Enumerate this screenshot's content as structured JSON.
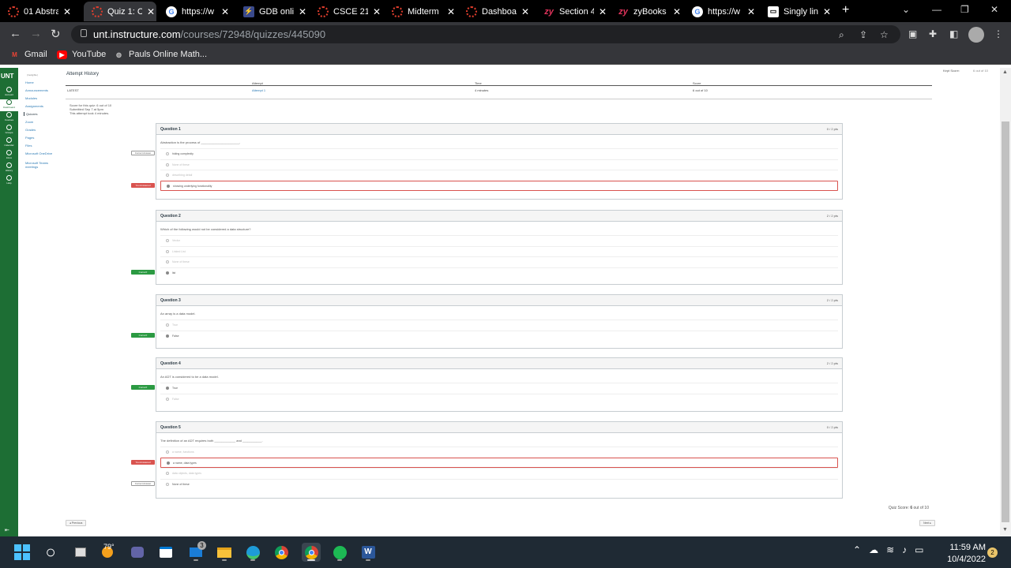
{
  "browser": {
    "tabs": [
      {
        "title": "01 Abstra",
        "icon": "canvas-icon",
        "active": false
      },
      {
        "title": "Quiz 1: C",
        "icon": "canvas-icon",
        "active": true
      },
      {
        "title": "https://w",
        "icon": "google-icon",
        "active": false
      },
      {
        "title": "GDB onli",
        "icon": "gdb-icon",
        "active": false
      },
      {
        "title": "CSCE 21",
        "icon": "canvas-icon",
        "active": false
      },
      {
        "title": "Midterm",
        "icon": "canvas-icon",
        "active": false
      },
      {
        "title": "Dashboa",
        "icon": "canvas-icon",
        "active": false
      },
      {
        "title": "Section 4",
        "icon": "zybooks-icon",
        "active": false
      },
      {
        "title": "zyBooks",
        "icon": "zybooks-icon",
        "active": false
      },
      {
        "title": "https://w",
        "icon": "google-icon",
        "active": false
      },
      {
        "title": "Singly lin",
        "icon": "window-icon",
        "active": false
      }
    ],
    "url_domain": "unt.instructure.com",
    "url_path": "/courses/72948/quizzes/445090",
    "bookmarks": [
      {
        "label": "Gmail",
        "icon": "gmail-icon"
      },
      {
        "label": "YouTube",
        "icon": "youtube-icon"
      },
      {
        "label": "Pauls Online Math...",
        "icon": "globe-icon"
      }
    ]
  },
  "global_nav": {
    "logo": "UNT",
    "items": [
      "Account",
      "Dashboard",
      "Courses",
      "Groups",
      "Calendar",
      "Inbox",
      "History",
      "Help"
    ],
    "active": "Dashboard"
  },
  "course_nav": {
    "term": "(Ineligible)",
    "items": [
      "Home",
      "Announcements",
      "Modules",
      "Assignments",
      "Quizzes",
      "Zoom",
      "Grades",
      "Pages",
      "Files",
      "Microsoft OneDrive",
      "Microsoft Teams meetings"
    ],
    "active": "Quizzes"
  },
  "attempt_history": {
    "title": "Attempt History",
    "headers": [
      "Attempt",
      "Time",
      "Score"
    ],
    "row": {
      "label": "LATEST",
      "attempt": "Attempt 1",
      "time": "4 minutes",
      "score": "6 out of 10"
    }
  },
  "summary": {
    "line1": "Score for this quiz: 6 out of 10",
    "line2": "Submitted Sep 7 at 5pm",
    "line3": "This attempt took 4 minutes."
  },
  "kept_score": {
    "label": "Kept Score:",
    "value": "6 out of 10"
  },
  "questions": [
    {
      "name": "Question 1",
      "points": "0 / 2 pts",
      "text": "Abstraction is the process of ______________________.",
      "answers": [
        {
          "text": "hiding complexity",
          "selected": false,
          "faded": false,
          "tag": "Correct Answer",
          "tag_style": "gray"
        },
        {
          "text": "None of these",
          "selected": false,
          "faded": true,
          "tag": "",
          "tag_style": ""
        },
        {
          "text": "describing detail",
          "selected": false,
          "faded": true,
          "tag": "",
          "tag_style": ""
        },
        {
          "text": "showing underlying functionality",
          "selected": true,
          "faded": false,
          "tag": "You Answered",
          "tag_style": "red"
        }
      ]
    },
    {
      "name": "Question 2",
      "points": "2 / 2 pts",
      "text": "Which of the following would not be considered a data structure?",
      "answers": [
        {
          "text": "Vector",
          "selected": false,
          "faded": true,
          "tag": "",
          "tag_style": ""
        },
        {
          "text": "Linked List",
          "selected": false,
          "faded": true,
          "tag": "",
          "tag_style": ""
        },
        {
          "text": "None of these",
          "selected": false,
          "faded": true,
          "tag": "",
          "tag_style": ""
        },
        {
          "text": "list",
          "selected": true,
          "faded": false,
          "tag": "Correct!",
          "tag_style": "green"
        }
      ]
    },
    {
      "name": "Question 3",
      "points": "2 / 2 pts",
      "text": "An array is a data model.",
      "answers": [
        {
          "text": "True",
          "selected": false,
          "faded": true,
          "tag": "",
          "tag_style": ""
        },
        {
          "text": "False",
          "selected": true,
          "faded": false,
          "tag": "Correct!",
          "tag_style": "green"
        }
      ]
    },
    {
      "name": "Question 4",
      "points": "2 / 2 pts",
      "text": "An ADT is considered to be a data model.",
      "answers": [
        {
          "text": "True",
          "selected": true,
          "faded": false,
          "tag": "Correct!",
          "tag_style": "green"
        },
        {
          "text": "False",
          "selected": false,
          "faded": true,
          "tag": "",
          "tag_style": ""
        }
      ]
    },
    {
      "name": "Question 5",
      "points": "0 / 2 pts",
      "text": "The definition of an ADT requires both ____________ and ___________.",
      "answers": [
        {
          "text": "a name, functions",
          "selected": false,
          "faded": true,
          "tag": "",
          "tag_style": ""
        },
        {
          "text": "a name, data types",
          "selected": true,
          "faded": false,
          "tag": "You Answered",
          "tag_style": "red"
        },
        {
          "text": "data objects, data types",
          "selected": false,
          "faded": true,
          "tag": "",
          "tag_style": ""
        },
        {
          "text": "None of these",
          "selected": false,
          "faded": false,
          "tag": "Correct Answer",
          "tag_style": "gray"
        }
      ]
    }
  ],
  "quiz_score": {
    "prefix": "Quiz Score: ",
    "score": "6",
    "suffix": " out of 10"
  },
  "pager": {
    "previous": "◂ Previous",
    "next": "Next ▸"
  },
  "taskbar": {
    "weather": "79°",
    "time": "11:59 AM",
    "date": "10/4/2022",
    "notifications": "2",
    "store_badge": "3"
  }
}
